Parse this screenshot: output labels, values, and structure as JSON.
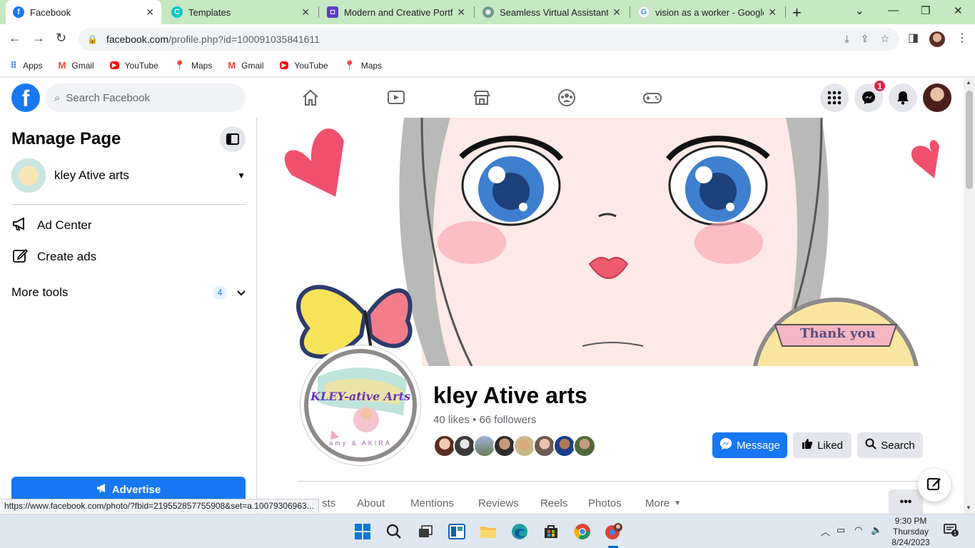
{
  "browser": {
    "tabs": [
      {
        "title": "Facebook",
        "active": true
      },
      {
        "title": "Templates",
        "active": false
      },
      {
        "title": "Modern and Creative Portfoli",
        "active": false
      },
      {
        "title": "Seamless Virtual Assistant Vi",
        "active": false
      },
      {
        "title": "vision as a worker - Google S",
        "active": false
      }
    ],
    "url_host": "facebook.com",
    "url_path": "/profile.php?id=100091035841611",
    "bookmarks": [
      {
        "label": "Apps",
        "icon": "apps-grid-icon"
      },
      {
        "label": "Gmail",
        "icon": "gmail-icon"
      },
      {
        "label": "YouTube",
        "icon": "youtube-icon"
      },
      {
        "label": "Maps",
        "icon": "maps-icon"
      },
      {
        "label": "Gmail",
        "icon": "gmail-icon"
      },
      {
        "label": "YouTube",
        "icon": "youtube-icon"
      },
      {
        "label": "Maps",
        "icon": "maps-icon"
      }
    ],
    "status_url": "https://www.facebook.com/photo/?fbid=219552857755908&set=a.10079306963..."
  },
  "fb": {
    "search_placeholder": "Search Facebook",
    "messenger_badge": "1",
    "brand_color": "#1877f2"
  },
  "sidebar": {
    "title": "Manage Page",
    "page_name": "kley Ative arts",
    "items": [
      {
        "label": "Ad Center",
        "icon": "megaphone-icon"
      },
      {
        "label": "Create ads",
        "icon": "edit-icon"
      }
    ],
    "more_tools_label": "More tools",
    "more_tools_count": "4",
    "advertise_label": "Advertise"
  },
  "profile": {
    "name": "kley Ative arts",
    "stats": "40 likes • 66 followers",
    "cover_text": "Thank you",
    "pic_text": "KLEY-ative Arts",
    "pic_subtext": "amy & AKIRA",
    "buttons": {
      "message": "Message",
      "liked": "Liked",
      "search": "Search"
    },
    "tabs": [
      "sts",
      "About",
      "Mentions",
      "Reviews",
      "Reels",
      "Photos",
      "More"
    ],
    "more_dots": "•••"
  },
  "taskbar": {
    "time": "9:30 PM",
    "day": "Thursday",
    "date": "8/24/2023",
    "notification_count": "1"
  }
}
